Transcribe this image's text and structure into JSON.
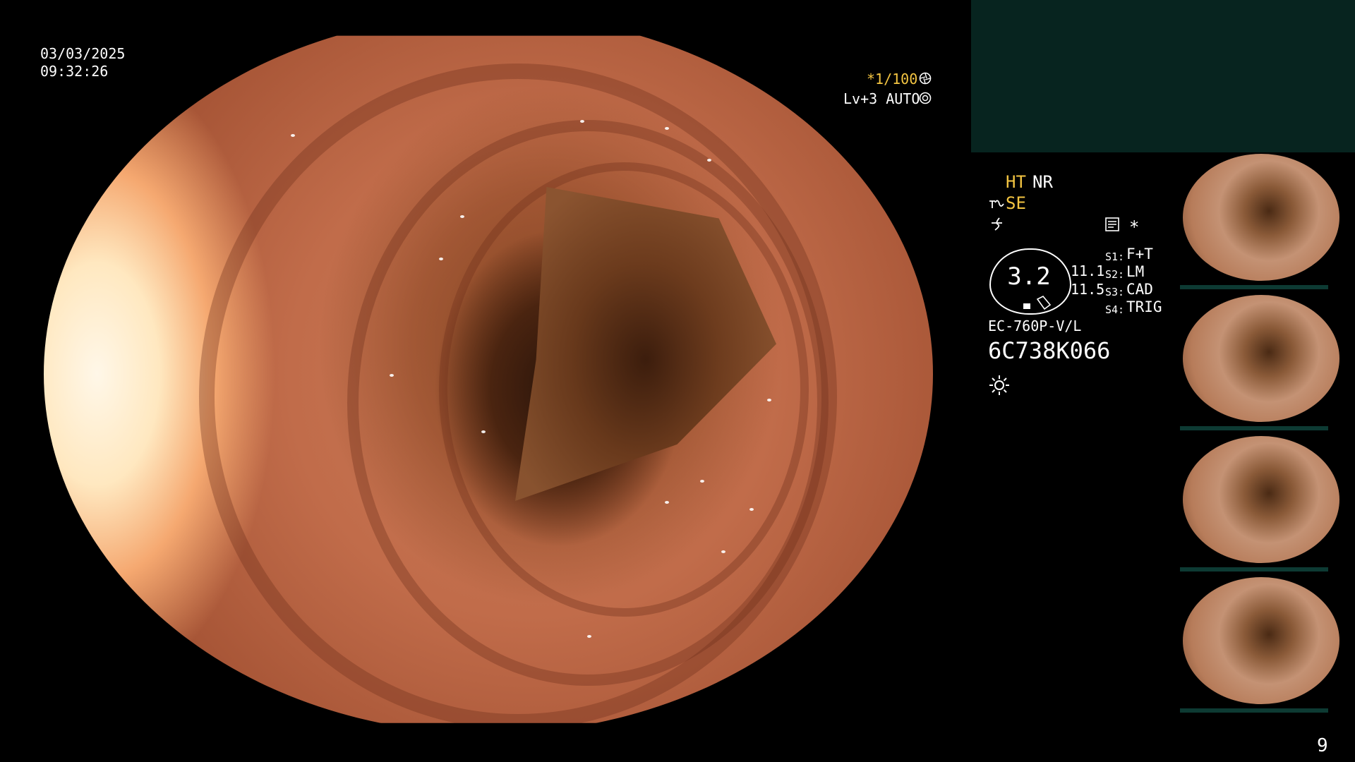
{
  "date": "03/03/2025",
  "time": "09:32:26",
  "shutter_label": "*1/100",
  "level_label": "Lv+3 AUTO",
  "mode_ht": "HT",
  "mode_nr": "NR",
  "mode_se": "SE",
  "asterisk": "*",
  "gauge_value": "3.2",
  "readout_1": "11.1",
  "readout_2": "11.5",
  "switches": {
    "s1_key": "S1:",
    "s1_val": "F+T",
    "s2_key": "S2:",
    "s2_val": "LM",
    "s3_key": "S3:",
    "s3_val": "CAD",
    "s4_key": "S4:",
    "s4_val": "TRIG"
  },
  "scope_model": "EC-760P-V/L",
  "scope_serial": "6C738K066",
  "page_number": "9",
  "colors": {
    "panel_bg": "#07241f",
    "accent_yellow": "#f4c542"
  },
  "icons": [
    "shutter-icon",
    "aperture-icon",
    "se-wave-icon",
    "squiggle-icon",
    "memo-icon",
    "sun-icon"
  ]
}
